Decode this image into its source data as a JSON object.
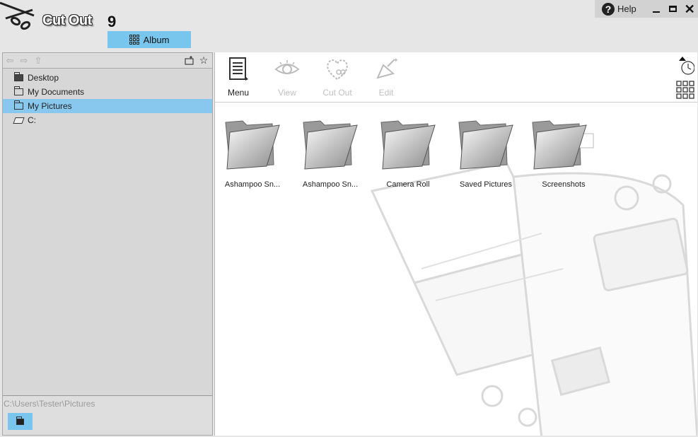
{
  "app": {
    "logo_text": "Cut Out",
    "version": "9"
  },
  "album_tab": {
    "label": "Album"
  },
  "window_controls": {
    "help_label": "Help",
    "help_glyph": "?"
  },
  "tree": {
    "items": [
      {
        "label": "Desktop",
        "icon": "desktop-folder-icon"
      },
      {
        "label": "My Documents",
        "icon": "folder-icon"
      },
      {
        "label": "My Pictures",
        "icon": "folder-icon",
        "selected": true
      },
      {
        "label": "C:",
        "icon": "drive-icon"
      }
    ]
  },
  "footer": {
    "path": "C:\\Users\\Tester\\Pictures"
  },
  "toolbar": {
    "menu": "Menu",
    "view": "View",
    "cutout": "Cut Out",
    "edit": "Edit"
  },
  "folders": [
    {
      "name": "Ashampoo Sn..."
    },
    {
      "name": "Ashampoo Sn..."
    },
    {
      "name": "Camera Roll"
    },
    {
      "name": "Saved Pictures"
    },
    {
      "name": "Screenshots"
    }
  ],
  "colors": {
    "accent": "#78c6ee",
    "selection": "#89c8ee",
    "panel": "#d7d7d7"
  }
}
